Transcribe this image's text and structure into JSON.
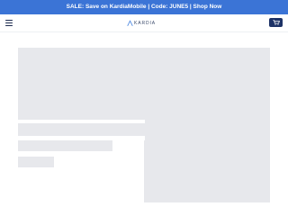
{
  "promo": {
    "text": "SALE: Save on KardiaMobile | Code: JUNE5 | Shop Now"
  },
  "header": {
    "brand": "KARDIA",
    "menu_icon": "hamburger-menu-icon",
    "cart_icon": "cart-icon"
  },
  "colors": {
    "promo_bg": "#3b74d6",
    "cart_bg": "#1d3266",
    "skeleton": "#e7e8ec"
  }
}
